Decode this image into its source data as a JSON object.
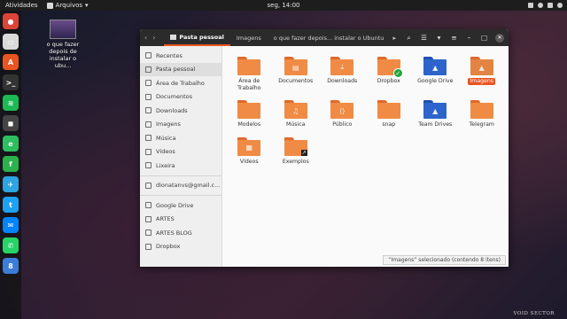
{
  "topbar": {
    "activities": "Atividades",
    "app_menu": "Arquivos",
    "clock": "seg, 14:00"
  },
  "dock": [
    {
      "name": "chrome-icon",
      "color": "#db4437",
      "glyph": "●"
    },
    {
      "name": "files-icon",
      "color": "#d9d9d9",
      "glyph": "▭"
    },
    {
      "name": "software-center-icon",
      "color": "#e95420",
      "glyph": "A"
    },
    {
      "name": "terminal-icon",
      "color": "#333333",
      "glyph": ">_"
    },
    {
      "name": "spotify-icon",
      "color": "#1db954",
      "glyph": "≋"
    },
    {
      "name": "screen-icon",
      "color": "#444444",
      "glyph": "◼"
    },
    {
      "name": "evernote-icon",
      "color": "#2dbe60",
      "glyph": "e"
    },
    {
      "name": "feedly-icon",
      "color": "#2bb24c",
      "glyph": "f"
    },
    {
      "name": "telegram-icon",
      "color": "#2ca5e0",
      "glyph": "✈"
    },
    {
      "name": "twitter-icon",
      "color": "#1da1f2",
      "glyph": "t"
    },
    {
      "name": "messenger-icon",
      "color": "#0084ff",
      "glyph": "✉"
    },
    {
      "name": "whatsapp-icon",
      "color": "#25d366",
      "glyph": "✆"
    },
    {
      "name": "calendar-icon",
      "color": "#3b7dd8",
      "glyph": "8"
    }
  ],
  "desktop": {
    "icon_label": "o que fazer depois de instalar o ubu..."
  },
  "window": {
    "breadcrumbs": [
      "Pasta pessoal",
      "Imagens",
      "o que fazer depois... instalar o Ubuntu"
    ],
    "more_glyph": "▸"
  },
  "sidebar": {
    "places": [
      {
        "label": "Recentes",
        "name": "sidebar-item-recentes"
      },
      {
        "label": "Pasta pessoal",
        "name": "sidebar-item-pasta-pessoal",
        "active": true
      },
      {
        "label": "Área de Trabalho",
        "name": "sidebar-item-area-de-trabalho"
      },
      {
        "label": "Documentos",
        "name": "sidebar-item-documentos"
      },
      {
        "label": "Downloads",
        "name": "sidebar-item-downloads"
      },
      {
        "label": "Imagens",
        "name": "sidebar-item-imagens"
      },
      {
        "label": "Música",
        "name": "sidebar-item-musica"
      },
      {
        "label": "Vídeos",
        "name": "sidebar-item-videos"
      },
      {
        "label": "Lixeira",
        "name": "sidebar-item-lixeira"
      }
    ],
    "account": "dionatanvs@gmail.c...",
    "bookmarks": [
      "Google Drive",
      "ARTES",
      "ARTES BLOG",
      "Dropbox"
    ]
  },
  "files": [
    {
      "label": "Área de Trabalho",
      "color": "orange",
      "glyph": ""
    },
    {
      "label": "Documentos",
      "color": "orange",
      "glyph": "▤"
    },
    {
      "label": "Downloads",
      "color": "orange",
      "glyph": "⤓"
    },
    {
      "label": "Dropbox",
      "color": "orange",
      "glyph": "",
      "badge": "ok"
    },
    {
      "label": "Google Drive",
      "color": "blue",
      "glyph": "▲"
    },
    {
      "label": "Imagens",
      "color": "orange",
      "glyph": "▲",
      "selected": true
    },
    {
      "label": "Modelos",
      "color": "orange",
      "glyph": ""
    },
    {
      "label": "Música",
      "color": "orange",
      "glyph": "♫"
    },
    {
      "label": "Público",
      "color": "orange",
      "glyph": "⟨⟩"
    },
    {
      "label": "snap",
      "color": "orange",
      "glyph": ""
    },
    {
      "label": "Team Drives",
      "color": "blue",
      "glyph": "▲"
    },
    {
      "label": "Telegram",
      "color": "orange",
      "glyph": ""
    },
    {
      "label": "Vídeos",
      "color": "orange",
      "glyph": "▦"
    },
    {
      "label": "Exemplos",
      "color": "orange",
      "glyph": "",
      "badge": "link"
    }
  ],
  "status": "“Imagens” selecionado  (contendo 8 itens)",
  "watermark": "VOID SECTOR"
}
